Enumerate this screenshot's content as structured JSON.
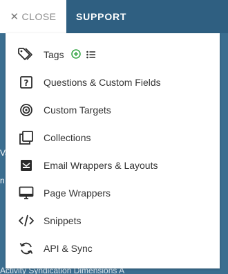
{
  "topbar": {
    "close_label": "CLOSE",
    "support_label": "SUPPORT"
  },
  "background": {
    "fragments": [
      "Va",
      "n C"
    ],
    "bottom_text": "Activity    Syndication    Dimensions    A"
  },
  "menu": {
    "items": [
      {
        "label": "Tags",
        "icon": "tag-icon"
      },
      {
        "label": "Questions & Custom Fields",
        "icon": "question-box-icon"
      },
      {
        "label": "Custom Targets",
        "icon": "target-icon"
      },
      {
        "label": "Collections",
        "icon": "collections-icon"
      },
      {
        "label": "Email Wrappers & Layouts",
        "icon": "envelope-icon"
      },
      {
        "label": "Page Wrappers",
        "icon": "monitor-icon"
      },
      {
        "label": "Snippets",
        "icon": "code-icon"
      },
      {
        "label": "API & Sync",
        "icon": "sync-icon"
      }
    ],
    "tags_add_icon": "add-circle-icon",
    "tags_list_icon": "list-icon"
  },
  "colors": {
    "topbar": "#2f5f81",
    "background": "#3b6e90",
    "add_green": "#3aa84a",
    "icon_dark": "#2b2b2b"
  }
}
